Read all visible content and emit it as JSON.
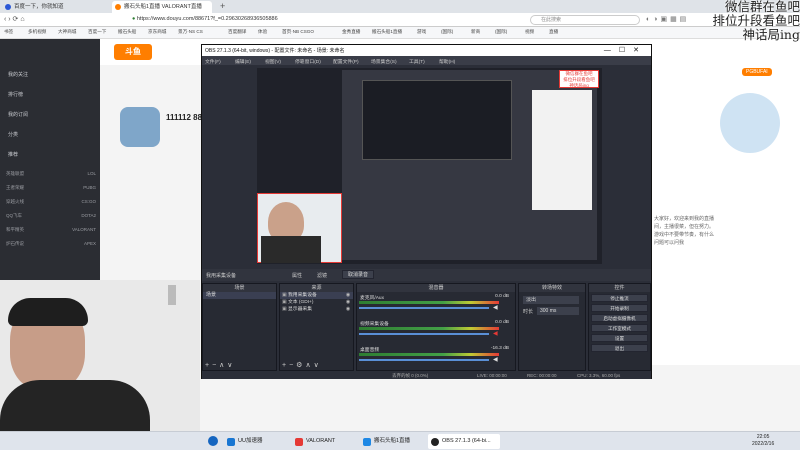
{
  "browser": {
    "tabs": [
      {
        "label": "百度一下，你就知道"
      },
      {
        "label": "搬石头船1直播 VALORANT直播"
      }
    ],
    "url": "https://www.douyu.com/88671?f_=0.29630268936505886",
    "search_placeholder": "在此搜索",
    "bookmarks": [
      "书签",
      "多机视频",
      "大神商城",
      "百度一下",
      "搬石头船",
      "京东商城",
      "景万·NS CS",
      "百度翻译",
      "体验",
      "首页·NB CSGO",
      "金秀直播",
      "搬石头船1直播",
      "游戏",
      "(国际)",
      "新商",
      "(国际)",
      "视频",
      "直播"
    ]
  },
  "site": {
    "logo": "斗鱼",
    "sidebar": [
      "我的关注",
      "排行榜",
      "我的订阅",
      "分类",
      "推荐"
    ],
    "categories": [
      [
        "英雄联盟",
        "LOL"
      ],
      [
        "王者荣耀",
        "PUBG"
      ],
      [
        "穿越火线",
        "CS:GO"
      ],
      [
        "QQ飞车",
        "DOTA2"
      ],
      [
        "和平精英",
        "VALORANT"
      ],
      [
        "炉石传说",
        "APEX"
      ]
    ],
    "room_number": "111112 88",
    "badge": "PGBUFAI",
    "right_text": "大家好，欢迎来到我的直播间，主播很菜，但在努力。游戏中不要带节奏，有什么问题可以问我"
  },
  "obs": {
    "title": "OBS 27.1.3 (64-bit, windows) - 配置文件: 未命名 - 场景: 未命名",
    "menu": [
      "文件(F)",
      "编辑(E)",
      "视图(V)",
      "停靠窗口(D)",
      "配置文件(P)",
      "场景集合(S)",
      "工具(T)",
      "帮助(H)"
    ],
    "source_bar": [
      "我用采集设备",
      "属性",
      "滤镜",
      "取消录音"
    ],
    "docks": {
      "scenes": {
        "title": "场景",
        "items": [
          "场景"
        ]
      },
      "sources": {
        "title": "来源",
        "items": [
          "我用采集设备",
          "文本 (GDI+)",
          "显示器采集"
        ]
      },
      "mixer": {
        "title": "混音器",
        "tracks": [
          {
            "name": "麦克风/Aux",
            "db": "0.0 dB"
          },
          {
            "name": "视频采集设备",
            "db": "0.0 dB"
          },
          {
            "name": "桌面音频",
            "db": "-16.3 dB"
          }
        ]
      },
      "transitions": {
        "title": "转场特效",
        "type": "淡出",
        "duration_label": "时长",
        "duration": "300 ms"
      },
      "controls": {
        "title": "控件",
        "buttons": [
          "停止推流",
          "开始录制",
          "启动虚拟摄像机",
          "工作室模式",
          "设置",
          "退出"
        ]
      }
    },
    "status": {
      "live": "LIVE: 00:00:00",
      "rec": "REC: 00:00:00",
      "cpu": "CPU: 3.3%, 60.00 fps",
      "dropped": "丢弃的帧 0 (0.0%)"
    },
    "preview_note": "微信群在鱼吧\n排位升段看鱼吧\n神话局ing"
  },
  "overlay": [
    "微信群在鱼吧",
    "排位升段看鱼吧",
    "神话局ing"
  ],
  "taskbar": {
    "items": [
      "UU加速器",
      "VALORANT",
      "搬石头船1直播",
      "OBS 27.1.3 (64-bi..."
    ],
    "time": "22:05",
    "date": "2022/2/16"
  },
  "colors": {
    "obs_bg": "#2b2e38",
    "sidebar_bg": "#2b2d33",
    "accent": "#ff7e00",
    "red": "#e53935"
  }
}
